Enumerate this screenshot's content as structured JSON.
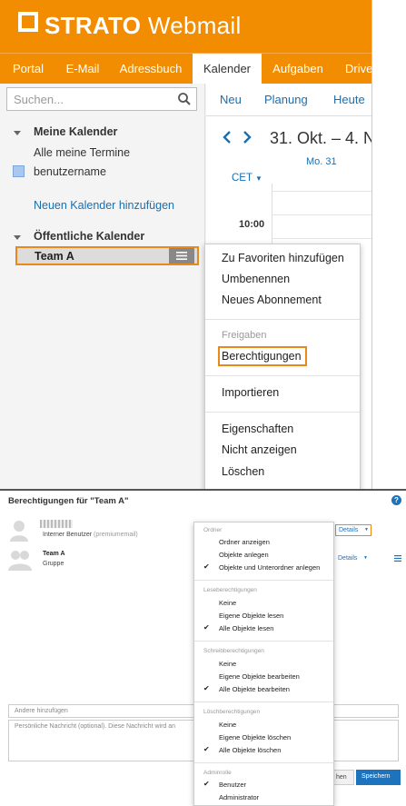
{
  "app": {
    "brand_bold": "STRATO",
    "brand_light": " Webmail"
  },
  "nav": {
    "tabs": [
      "Portal",
      "E-Mail",
      "Adressbuch",
      "Kalender",
      "Aufgaben",
      "Drive"
    ],
    "active": "Kalender"
  },
  "sidebar": {
    "search_placeholder": "Suchen...",
    "my_calendars_heading": "Meine Kalender",
    "all_appointments": "Alle meine Termine",
    "user_calendar": "benutzername",
    "add_calendar_link": "Neuen Kalender hinzufügen",
    "public_calendars_heading": "Öffentliche Kalender",
    "team_calendar": "Team A"
  },
  "calendar": {
    "toolbar": [
      "Neu",
      "Planung",
      "Heute"
    ],
    "range_title": "31. Okt. – 4. N",
    "day_header": "Mo. 31",
    "timezone": "CET",
    "time_label": "10:00",
    "user_calendar_color": "#a9c8ef"
  },
  "context_menu": {
    "items": [
      "Zu Favoriten hinzufügen",
      "Umbenennen",
      "Neues Abonnement"
    ],
    "share_section": "Freigaben",
    "permissions": "Berechtigungen",
    "import": "Importieren",
    "properties": "Eigenschaften",
    "hide": "Nicht anzeigen",
    "delete": "Löschen"
  },
  "dialog": {
    "title": "Berechtigungen für \"Team A\"",
    "help": "?",
    "user_role": "Interner Benutzer",
    "user_plan": "(premiumemail)",
    "group_name": "Team A",
    "group_type": "Gruppe",
    "details_label": "Details",
    "add_others_placeholder": "Andere hinzufügen",
    "message_placeholder": "Persönliche Nachricht (optional). Diese Nachricht wird an",
    "cancel_partial": "hen",
    "save": "Speichern"
  },
  "permissions_dropdown": {
    "sections": [
      {
        "title": "Ordner",
        "items": [
          {
            "label": "Ordner anzeigen",
            "checked": false
          },
          {
            "label": "Objekte anlegen",
            "checked": false
          },
          {
            "label": "Objekte und Unterordner anlegen",
            "checked": true
          }
        ]
      },
      {
        "title": "Leseberechtigungen",
        "items": [
          {
            "label": "Keine",
            "checked": false
          },
          {
            "label": "Eigene Objekte lesen",
            "checked": false
          },
          {
            "label": "Alle Objekte lesen",
            "checked": true
          }
        ]
      },
      {
        "title": "Schreibberechtigungen",
        "items": [
          {
            "label": "Keine",
            "checked": false
          },
          {
            "label": "Eigene Objekte bearbeiten",
            "checked": false
          },
          {
            "label": "Alle Objekte bearbeiten",
            "checked": true
          }
        ]
      },
      {
        "title": "Löschberechtigungen",
        "items": [
          {
            "label": "Keine",
            "checked": false
          },
          {
            "label": "Eigene Objekte löschen",
            "checked": false
          },
          {
            "label": "Alle Objekte löschen",
            "checked": true
          }
        ]
      },
      {
        "title": "Adminrolle",
        "items": [
          {
            "label": "Benutzer",
            "checked": true
          },
          {
            "label": "Administrator",
            "checked": false
          }
        ]
      }
    ]
  },
  "colors": {
    "brand_orange": "#f28c00",
    "link_blue": "#1a6fb0",
    "highlight_orange": "#e8891a",
    "save_blue": "#1d73be"
  }
}
